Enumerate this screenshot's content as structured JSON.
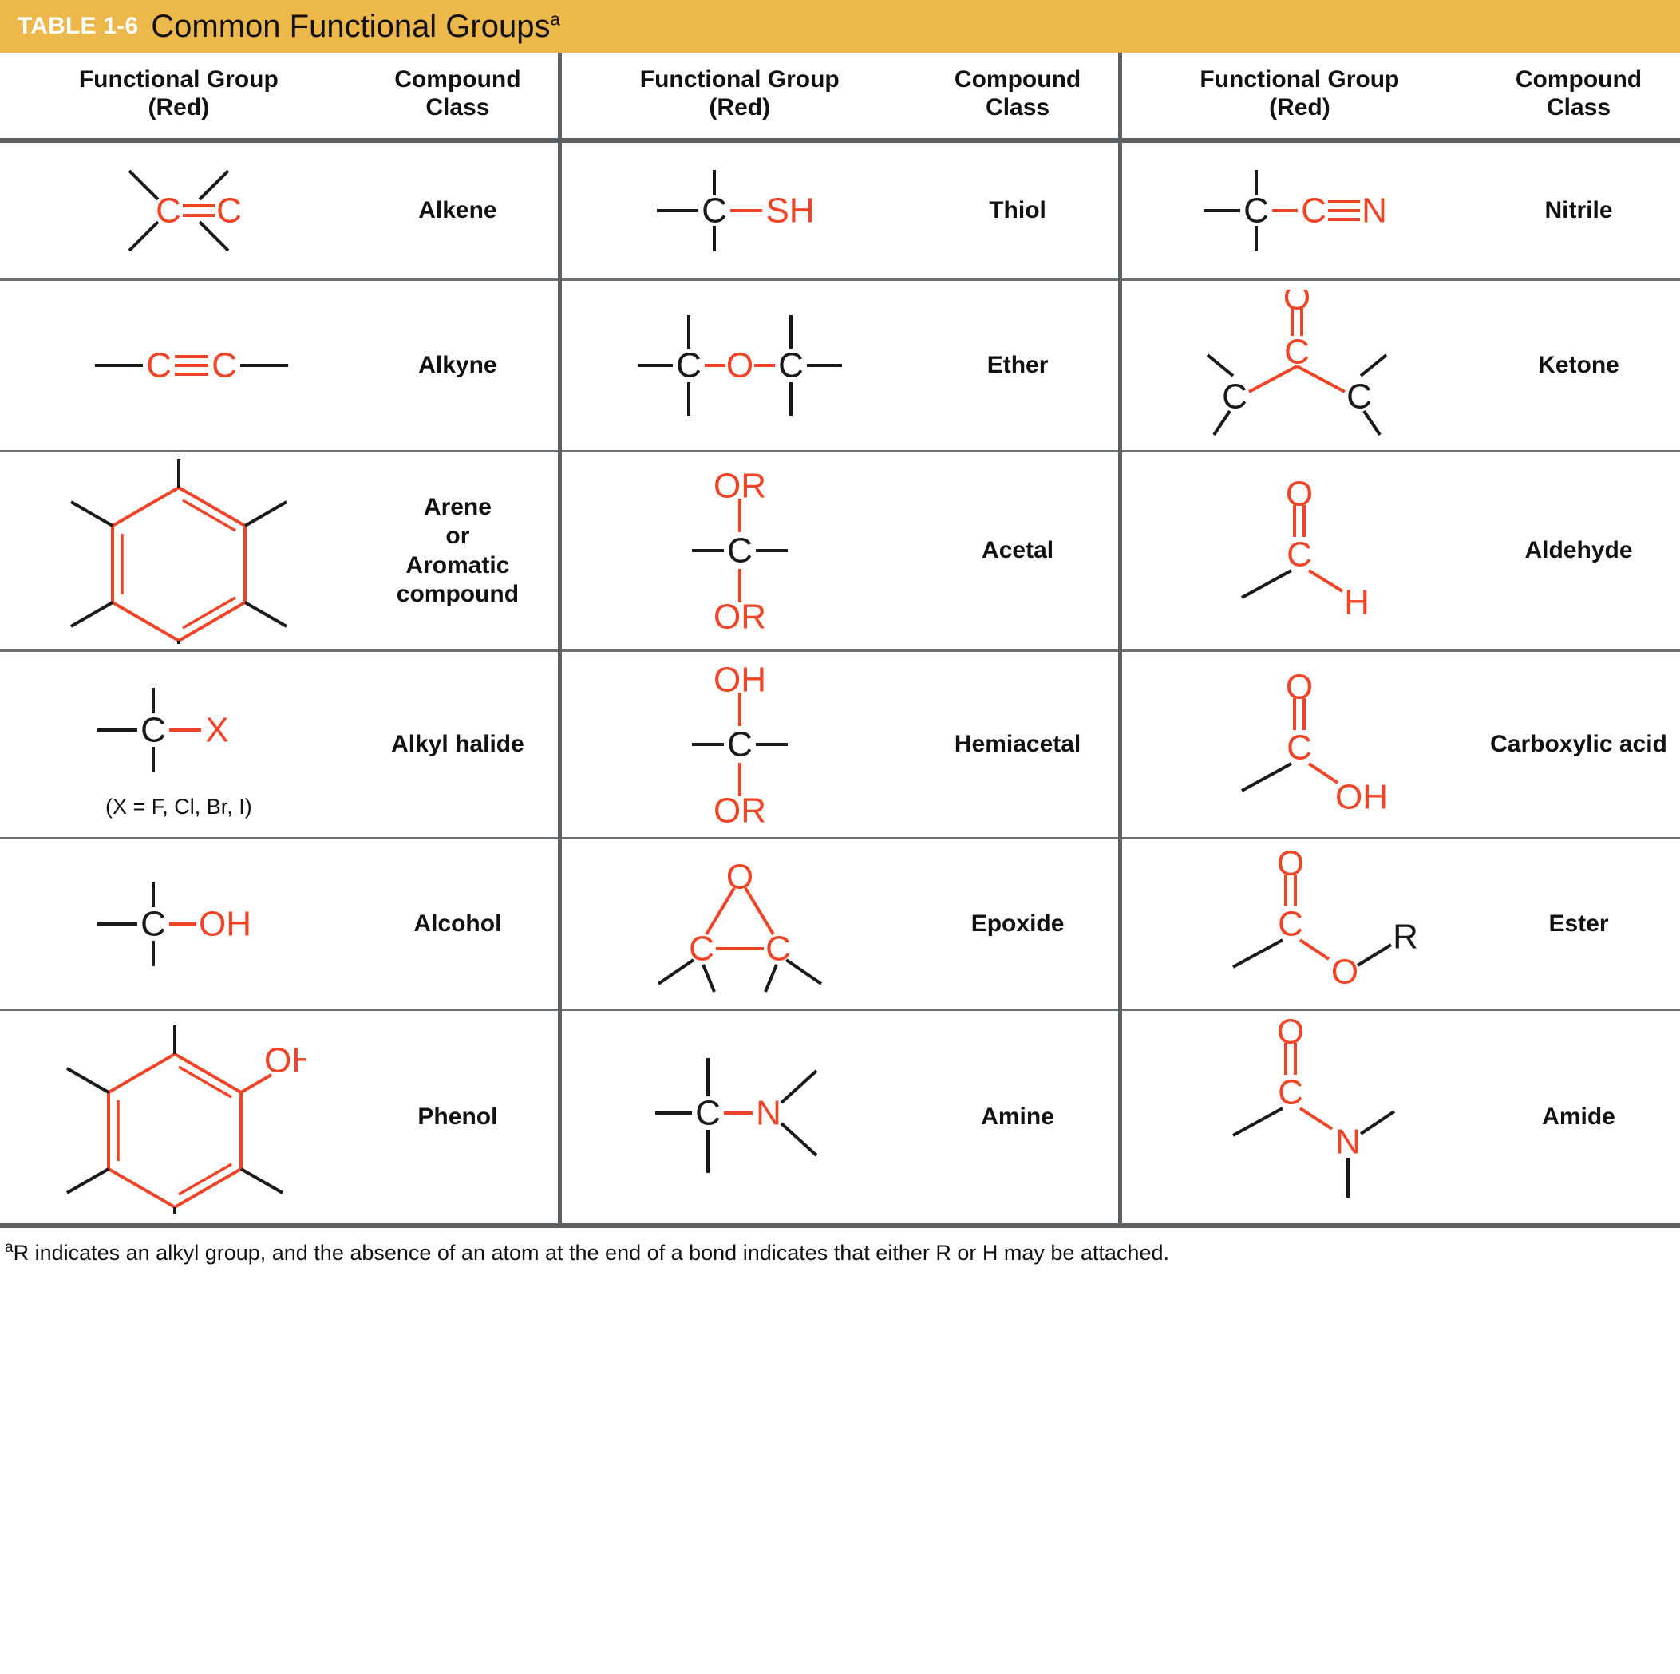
{
  "title": {
    "tag": "TABLE 1-6",
    "text": "Common Functional Groups",
    "superscript": "a"
  },
  "headers": {
    "functional_group_line1": "Functional Group",
    "functional_group_line2": "(Red)",
    "compound_line1": "Compound",
    "compound_line2": "Class"
  },
  "colors": {
    "title_bar": "#edb84b",
    "title_tag": "#ffffff",
    "functional_group_red": "#f04427",
    "bond_black": "#1a1a1a",
    "rule": "#5c6063"
  },
  "footnote": {
    "marker": "a",
    "text": "R indicates an alkyl group, and the absence of an atom at the end of a bond indicates that either R or H may be attached."
  },
  "chart_data": {
    "type": "table",
    "title": "Common Functional Groups",
    "columns": [
      "Functional Group (Red)",
      "Compound Class",
      "Functional Group (Red)",
      "Compound Class",
      "Functional Group (Red)",
      "Compound Class"
    ],
    "rows": [
      {
        "col1": {
          "class": "Alkene",
          "formula": "C=C",
          "red_atoms": [
            "C",
            "C"
          ],
          "red_bond": "double"
        },
        "col2": {
          "class": "Thiol",
          "formula": "C-SH",
          "red_atoms": [
            "SH"
          ],
          "red_bond": "single"
        },
        "col3": {
          "class": "Nitrile",
          "formula": "C-C#N",
          "red_atoms": [
            "C",
            "N"
          ],
          "red_bond": "triple"
        }
      },
      {
        "col1": {
          "class": "Alkyne",
          "formula": "C#C",
          "red_atoms": [
            "C",
            "C"
          ],
          "red_bond": "triple"
        },
        "col2": {
          "class": "Ether",
          "formula": "C-O-C",
          "red_atoms": [
            "O"
          ],
          "red_bond": "single"
        },
        "col3": {
          "class": "Ketone",
          "formula": "C(=O)C",
          "red_atoms": [
            "C",
            "O"
          ],
          "red_bond": "double"
        }
      },
      {
        "col1": {
          "class": "Arene or Aromatic compound",
          "class_lines": [
            "Arene",
            "or",
            "Aromatic",
            "compound"
          ],
          "formula": "benzene ring",
          "red_atoms": [],
          "red_bond": "aromatic"
        },
        "col2": {
          "class": "Acetal",
          "formula": "C(OR)OR",
          "red_atoms": [
            "OR",
            "OR"
          ],
          "red_bond": "single"
        },
        "col3": {
          "class": "Aldehyde",
          "formula": "C(=O)H",
          "red_atoms": [
            "C",
            "O",
            "H"
          ],
          "red_bond": "double"
        }
      },
      {
        "col1": {
          "class": "Alkyl halide",
          "formula": "C-X",
          "red_atoms": [
            "X"
          ],
          "red_bond": "single",
          "note": "(X = F, Cl, Br, I)"
        },
        "col2": {
          "class": "Hemiacetal",
          "formula": "C(OH)OR",
          "red_atoms": [
            "OH",
            "OR"
          ],
          "red_bond": "single"
        },
        "col3": {
          "class": "Carboxylic acid",
          "formula": "C(=O)OH",
          "red_atoms": [
            "C",
            "O",
            "OH"
          ],
          "red_bond": "double"
        }
      },
      {
        "col1": {
          "class": "Alcohol",
          "formula": "C-OH",
          "red_atoms": [
            "OH"
          ],
          "red_bond": "single"
        },
        "col2": {
          "class": "Epoxide",
          "formula": "C-O-C ring",
          "red_atoms": [
            "O"
          ],
          "red_bond": "ring"
        },
        "col3": {
          "class": "Ester",
          "formula": "C(=O)O-R",
          "red_atoms": [
            "C",
            "O",
            "O"
          ],
          "red_bond": "double"
        }
      },
      {
        "col1": {
          "class": "Phenol",
          "formula": "Ar-OH",
          "red_atoms": [
            "OH"
          ],
          "red_bond": "aromatic"
        },
        "col2": {
          "class": "Amine",
          "formula": "C-N",
          "red_atoms": [
            "N"
          ],
          "red_bond": "single"
        },
        "col3": {
          "class": "Amide",
          "formula": "C(=O)N",
          "red_atoms": [
            "C",
            "O",
            "N"
          ],
          "red_bond": "double"
        }
      }
    ],
    "atom_labels": {
      "C": "C",
      "N": "N",
      "O": "O",
      "H": "H",
      "X": "X",
      "R": "R",
      "SH": "SH",
      "OH": "OH",
      "OR": "OR"
    }
  }
}
